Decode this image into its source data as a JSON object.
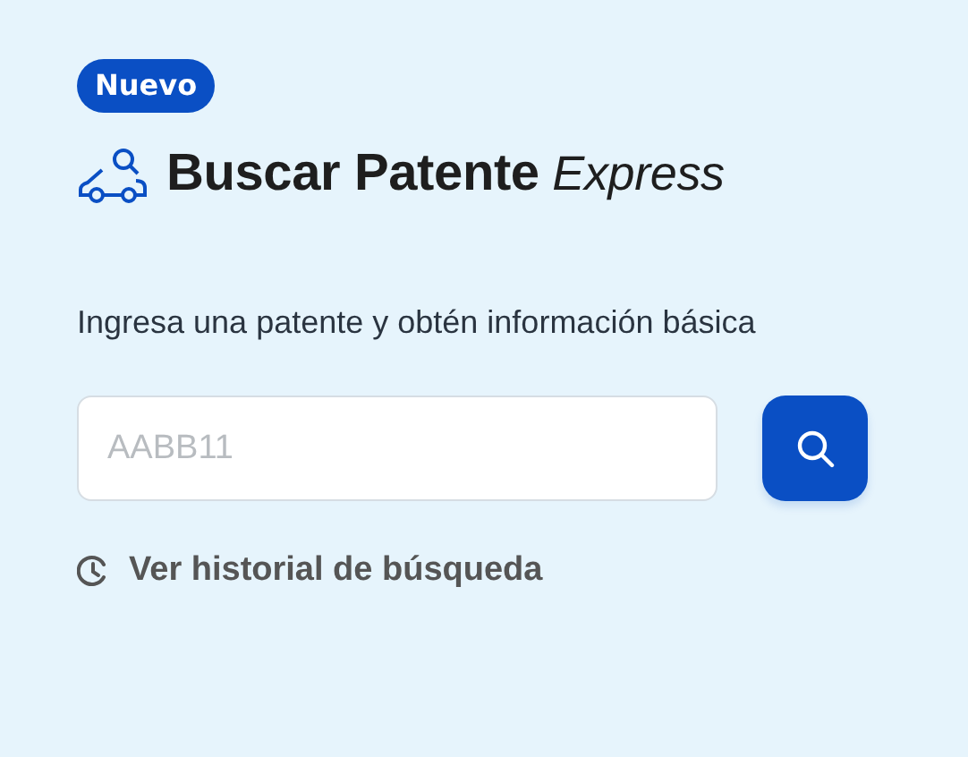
{
  "badge": "Nuevo",
  "title": "**Buscar Patente** *Express*",
  "description": "Ingresa una patente y obtén información básica",
  "search": {
    "placeholder": "AABB11"
  },
  "history_link": "Ver historial de búsqueda"
}
